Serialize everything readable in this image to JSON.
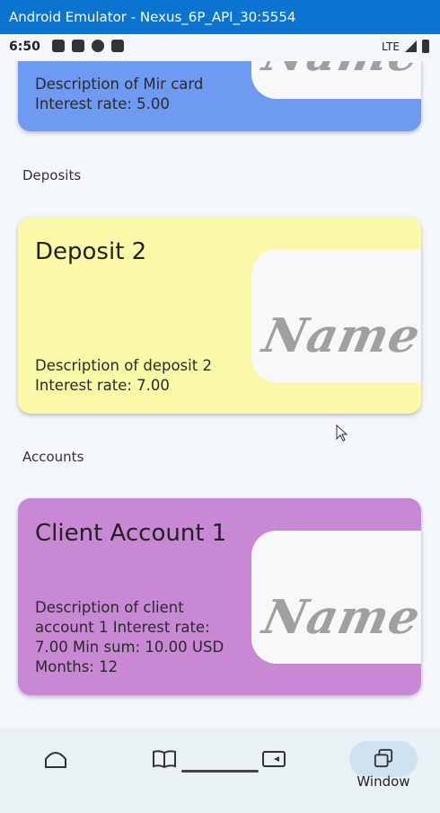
{
  "window": {
    "title": "Android Emulator - Nexus_6P_API_30:5554"
  },
  "statusbar": {
    "time": "6:50",
    "network": "LTE"
  },
  "cards": {
    "mir": {
      "desc": "Description of Mir card Interest rate: 5.00",
      "name_text": "Name",
      "color": "#6f9af2"
    },
    "deposit2": {
      "title": "Deposit 2",
      "desc": "Description of deposit 2 Interest rate: 7.00",
      "name_text": "Name",
      "color": "#f9f9a8"
    },
    "account1": {
      "title": "Client Account 1",
      "desc": "Description of client account 1 Interest rate: 7.00 Min sum: 10.00 USD Months: 12",
      "name_text": "Name",
      "color": "#c888d4"
    }
  },
  "sections": {
    "deposits": "Deposits",
    "accounts": "Accounts"
  },
  "nav": {
    "window_label": "Window"
  }
}
